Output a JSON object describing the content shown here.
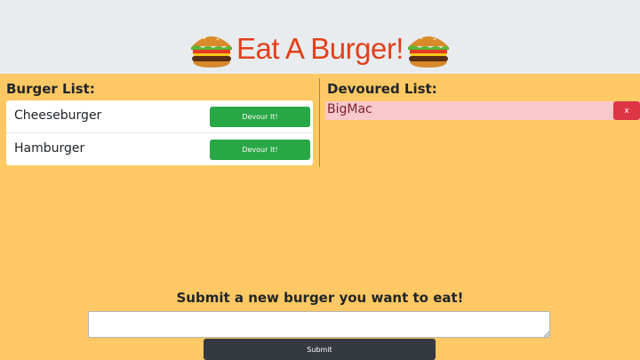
{
  "header": {
    "title": "Eat A Burger!",
    "icon_left": "burger-icon",
    "icon_right": "burger-icon"
  },
  "burger_list": {
    "heading": "Burger List:",
    "items": [
      {
        "name": "Cheeseburger",
        "button_label": "Devour It!"
      },
      {
        "name": "Hamburger",
        "button_label": "Devour It!"
      }
    ]
  },
  "devoured_list": {
    "heading": "Devoured List:",
    "items": [
      {
        "name": "BigMac",
        "delete_label": "x"
      }
    ]
  },
  "form": {
    "heading": "Submit a new burger you want to eat!",
    "input_value": "",
    "submit_label": "Submit"
  },
  "colors": {
    "background": "#fec864",
    "header_bg": "#e9ecef",
    "title": "#e2401a",
    "devour_button": "#28a745",
    "delete_button": "#dc3545",
    "devoured_item_bg": "#f8c8cc",
    "submit_button": "#343a40"
  }
}
